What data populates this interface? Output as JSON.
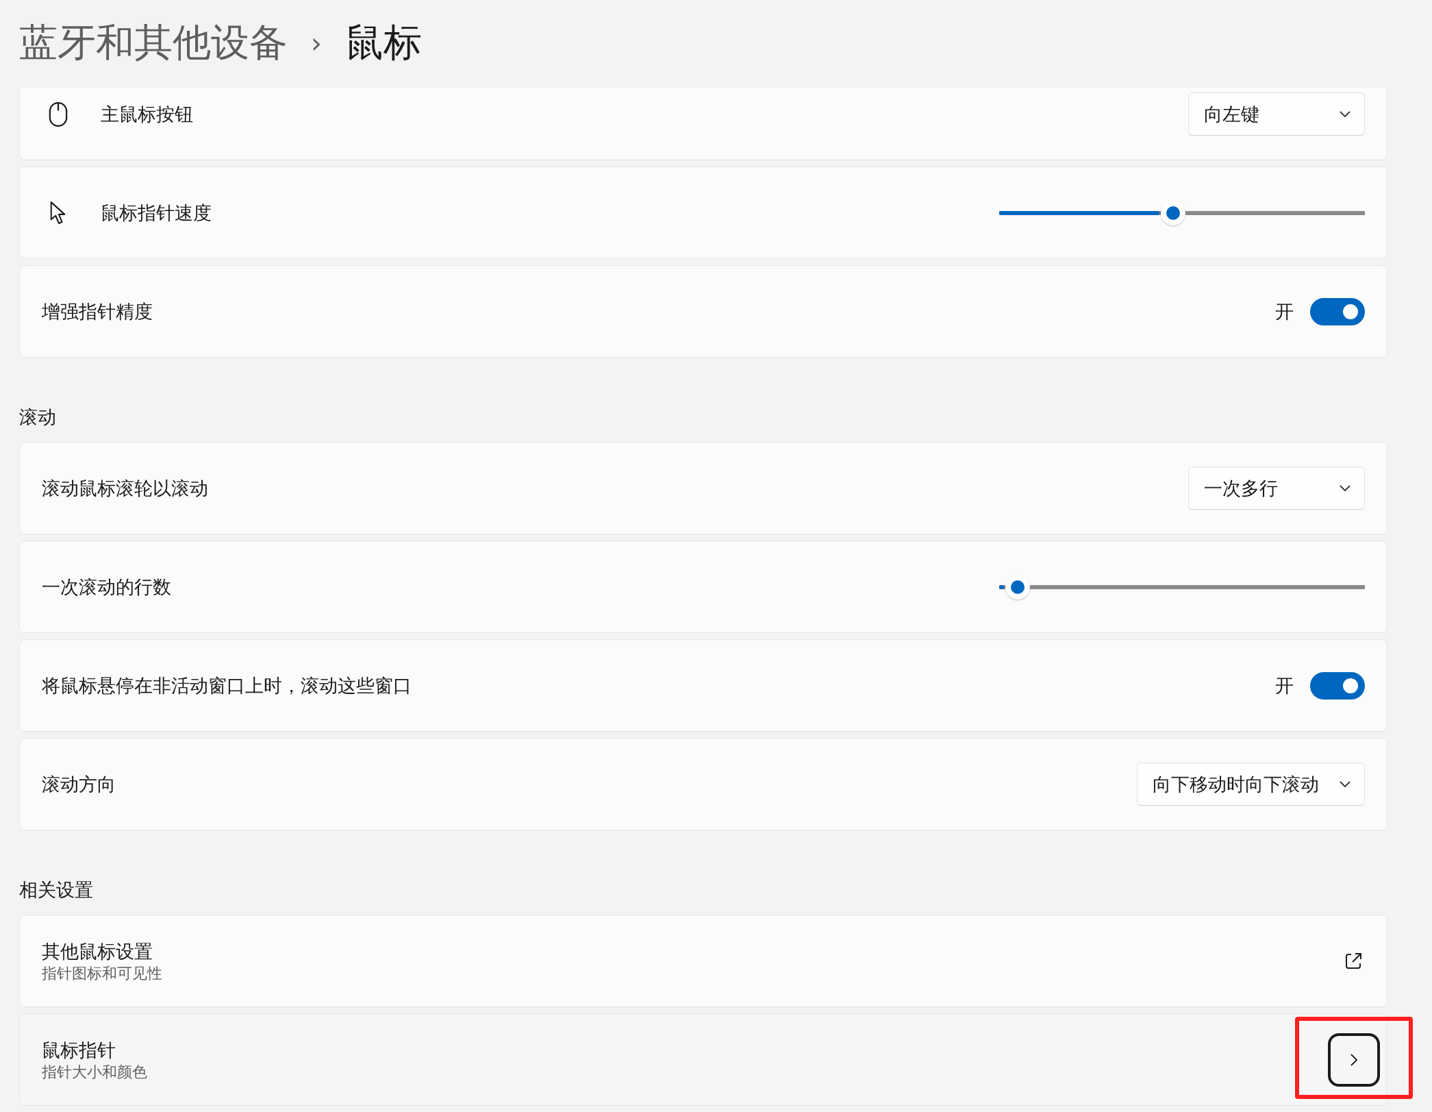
{
  "breadcrumb": {
    "parent": "蓝牙和其他设备",
    "separator": "›",
    "current": "鼠标"
  },
  "groups": [
    {
      "items": [
        {
          "kind": "dropdown",
          "icon": {
            "kind": "mouse"
          },
          "label": "主鼠标按钮",
          "value": "向左键"
        },
        {
          "kind": "slider",
          "icon": {
            "kind": "pointer"
          },
          "label": "鼠标指针速度",
          "level": 0.476
        },
        {
          "kind": "toggle",
          "label": "增强指针精度",
          "state_label": "开",
          "on": true
        }
      ]
    },
    {
      "title": "滚动",
      "items": [
        {
          "kind": "dropdown",
          "label": "滚动鼠标滚轮以滚动",
          "value": "一次多行"
        },
        {
          "kind": "slider",
          "label": "一次滚动的行数",
          "level": 0.05
        },
        {
          "kind": "toggle",
          "label": "将鼠标悬停在非活动窗口上时，滚动这些窗口",
          "state_label": "开",
          "on": true
        },
        {
          "kind": "dropdown",
          "label": "滚动方向",
          "value": "向下移动时向下滚动"
        }
      ]
    },
    {
      "title": "相关设置",
      "items": [
        {
          "kind": "link",
          "label": "其他鼠标设置",
          "description": "指针图标和可见性",
          "highlighted": false
        },
        {
          "kind": "nav",
          "label": "鼠标指针",
          "description": "指针大小和颜色",
          "highlighted": true
        }
      ]
    }
  ]
}
